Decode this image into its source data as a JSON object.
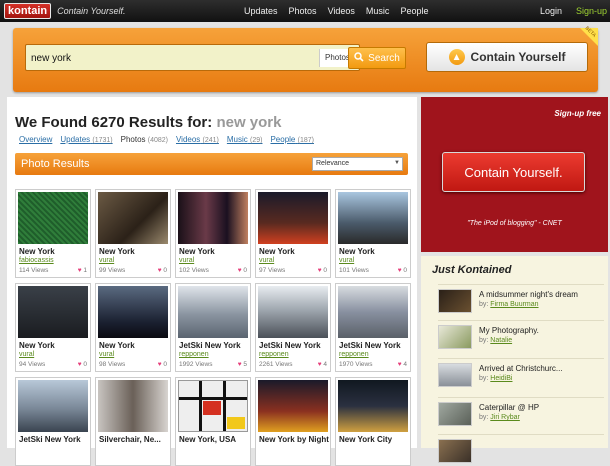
{
  "topbar": {
    "logo": "kontain",
    "tagline": "Contain Yourself.",
    "nav": [
      "Updates",
      "Photos",
      "Videos",
      "Music",
      "People"
    ],
    "login": "Login",
    "signup": "Sign-up"
  },
  "search": {
    "value": "new york",
    "filter": "Photos",
    "button": "Search",
    "cta": "Contain Yourself",
    "badge": "BETA"
  },
  "results": {
    "prefix": "We Found 6270 Results for:",
    "query": "new york",
    "tabs": [
      {
        "label": "Overview",
        "count": ""
      },
      {
        "label": "Updates",
        "count": "(1731)"
      },
      {
        "label": "Photos",
        "count": "(4082)"
      },
      {
        "label": "Videos",
        "count": "(241)"
      },
      {
        "label": "Music",
        "count": "(29)"
      },
      {
        "label": "People",
        "count": "(187)"
      }
    ],
    "section_title": "Photo Results",
    "sort": "Relevance"
  },
  "photos": [
    {
      "title": "New York",
      "user": "fabiocassis",
      "views": "114 Views",
      "hearts": "1"
    },
    {
      "title": "New York",
      "user": "vural",
      "views": "99 Views",
      "hearts": "0"
    },
    {
      "title": "New York",
      "user": "vural",
      "views": "102 Views",
      "hearts": "0"
    },
    {
      "title": "New York",
      "user": "vural",
      "views": "97 Views",
      "hearts": "0"
    },
    {
      "title": "New York",
      "user": "vural",
      "views": "101 Views",
      "hearts": "0"
    },
    {
      "title": "New York",
      "user": "vural",
      "views": "94 Views",
      "hearts": "0"
    },
    {
      "title": "New York",
      "user": "vural",
      "views": "98 Views",
      "hearts": "0"
    },
    {
      "title": "JetSki New York",
      "user": "repponen",
      "views": "1992 Views",
      "hearts": "5"
    },
    {
      "title": "JetSki New York",
      "user": "repponen",
      "views": "2261 Views",
      "hearts": "4"
    },
    {
      "title": "JetSki New York",
      "user": "repponen",
      "views": "1970 Views",
      "hearts": "4"
    },
    {
      "title": "JetSki New York",
      "user": "",
      "views": "",
      "hearts": ""
    },
    {
      "title": "Silverchair, Ne...",
      "user": "",
      "views": "",
      "hearts": ""
    },
    {
      "title": "New York, USA",
      "user": "",
      "views": "",
      "hearts": ""
    },
    {
      "title": "New York by Night",
      "user": "",
      "views": "",
      "hearts": ""
    },
    {
      "title": "New York City",
      "user": "",
      "views": "",
      "hearts": ""
    }
  ],
  "ad": {
    "top": "Sign-up free",
    "button": "Contain Yourself.",
    "quote": "\"The iPod of blogging\" - CNET"
  },
  "just_kontained": {
    "title": "Just Kontained",
    "by": "by:",
    "items": [
      {
        "title": "A midsummer night's dream",
        "user": "Firma Buurman"
      },
      {
        "title": "My Photography.",
        "user": "Natalie"
      },
      {
        "title": "Arrived at Christchurc...",
        "user": "HeidiBi"
      },
      {
        "title": "Caterpillar @ HP",
        "user": "Jiri Rybar"
      },
      {
        "title": "",
        "user": ""
      }
    ]
  },
  "colors": {
    "orange": "#f08a1c",
    "red": "#a0141c",
    "link": "#2a6ea6",
    "green": "#5a8a1c",
    "heart": "#e63f7b"
  },
  "icons": {
    "search": "search-icon",
    "arrow": "arrow-up-icon",
    "heart": "heart-icon",
    "dropdown": "chevron-down-icon"
  }
}
